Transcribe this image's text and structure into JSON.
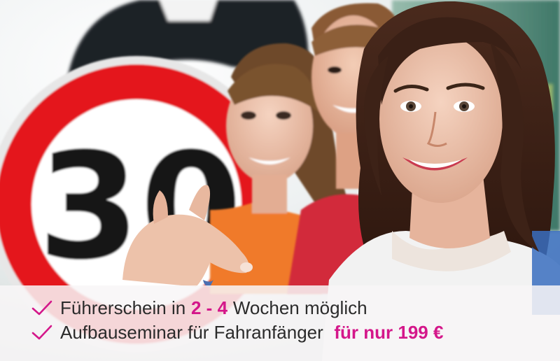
{
  "photo": {
    "sign_number": "30"
  },
  "banner": {
    "accent_color": "#d4178a",
    "line1": {
      "before": "Führerschein in",
      "highlight": "2 - 4",
      "after": "Wochen möglich"
    },
    "line2": {
      "before": "Aufbauseminar für Fahranfänger",
      "highlight": "für nur 199 €"
    },
    "icon": "checkmark-icon"
  }
}
